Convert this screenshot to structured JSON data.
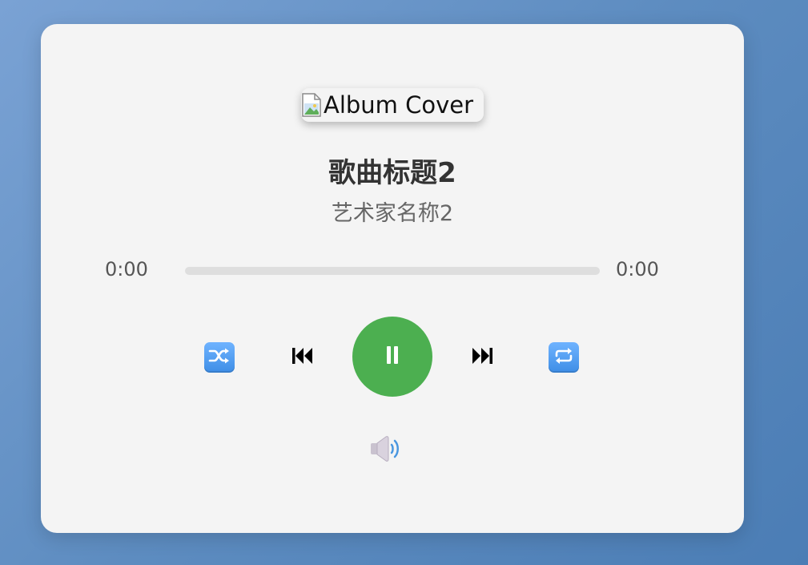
{
  "album": {
    "alt": "Album Cover"
  },
  "track": {
    "title": "歌曲标题2",
    "artist": "艺术家名称2"
  },
  "progress": {
    "current_time": "0:00",
    "total_time": "0:00",
    "fraction": 0
  },
  "controls": {
    "shuffle_icon": "shuffle-icon",
    "previous_icon": "previous-track-icon",
    "play_state": "playing",
    "pause_icon": "pause-icon",
    "next_icon": "next-track-icon",
    "repeat_icon": "repeat-icon",
    "volume_icon": "speaker-icon"
  },
  "colors": {
    "accent": "#4caf50",
    "card": "#f4f4f4",
    "icon_blue": "#3e8ee6"
  }
}
